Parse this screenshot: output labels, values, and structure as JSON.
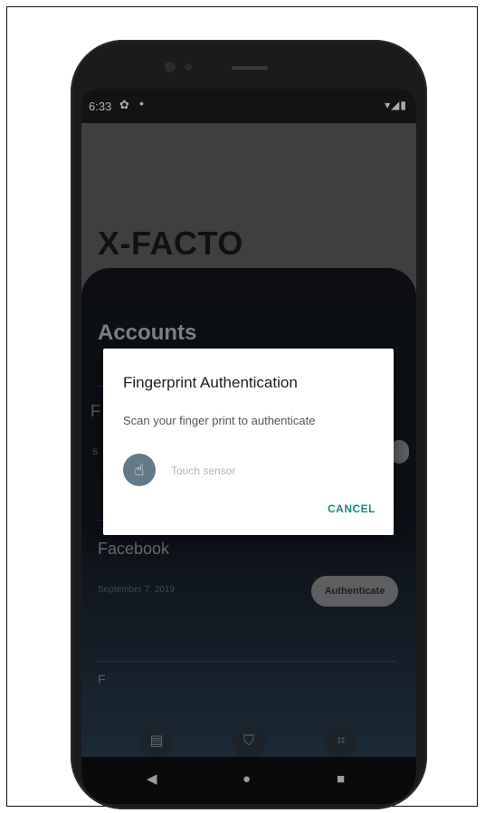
{
  "status_bar": {
    "time": "6:33",
    "settings_icon": "gear-icon",
    "notification_dot": "•",
    "right_icons": "▾◢▮"
  },
  "app": {
    "title": "X-FACTO"
  },
  "accounts": {
    "title": "Accounts",
    "items": [
      {
        "name": "F",
        "date": "S",
        "button": ""
      },
      {
        "name": "Facebook",
        "date": "September 7, 2019",
        "button": "Authenticate"
      },
      {
        "name": "F",
        "date": "",
        "button": ""
      }
    ]
  },
  "bottom_nav": {
    "icons": [
      "list-icon",
      "shield-icon",
      "qr-scan-icon"
    ]
  },
  "dialog": {
    "title": "Fingerprint Authentication",
    "description": "Scan your finger print to authenticate",
    "fingerprint_icon": "fingerprint-icon",
    "status": "Touch sensor",
    "cancel_label": "CANCEL"
  },
  "system_nav": {
    "back": "◀",
    "home": "●",
    "recents": "■"
  },
  "colors": {
    "accent": "#1a8a7a",
    "panel": "#141a22",
    "header": "#5e5e5e"
  }
}
